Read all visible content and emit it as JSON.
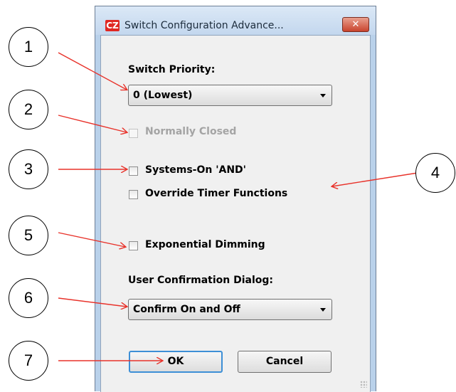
{
  "window": {
    "title": "Switch Configuration Advance...",
    "app_icon_text": "CZ",
    "close_glyph": "✕"
  },
  "form": {
    "priority_label": "Switch Priority:",
    "priority_value": "0 (Lowest)",
    "checkboxes": [
      {
        "label": "Normally Closed",
        "checked": false,
        "enabled": false
      },
      {
        "label": "Systems-On 'AND'",
        "checked": false,
        "enabled": true
      },
      {
        "label": "Override Timer Functions",
        "checked": false,
        "enabled": true
      },
      {
        "label": "Exponential Dimming",
        "checked": false,
        "enabled": true
      }
    ],
    "confirm_label": "User Confirmation Dialog:",
    "confirm_value": "Confirm On and Off",
    "ok_label": "OK",
    "cancel_label": "Cancel"
  },
  "callouts": [
    "1",
    "2",
    "3",
    "4",
    "5",
    "6",
    "7"
  ],
  "colors": {
    "arrow": "#e8322a",
    "window_frame": "#b9d1ea",
    "client_bg": "#f0f0f0",
    "default_button_border": "#3d8fd6"
  }
}
